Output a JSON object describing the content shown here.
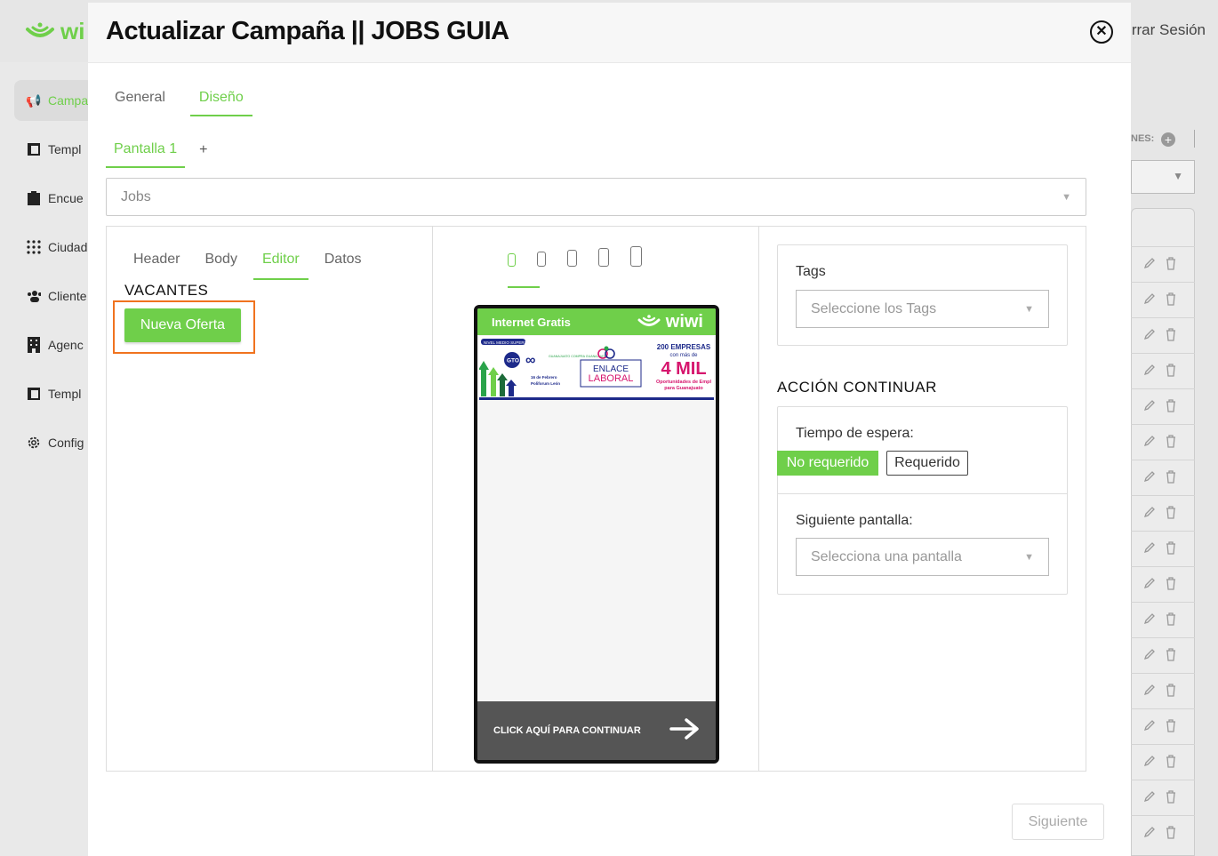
{
  "background": {
    "logo_text": "wi",
    "logout_label": "rrar Sesión",
    "sidebar": {
      "items": [
        {
          "label": "Campa",
          "icon": "megaphone-icon",
          "active": true
        },
        {
          "label": "Templ",
          "icon": "template-icon"
        },
        {
          "label": "Encue",
          "icon": "clipboard-icon"
        },
        {
          "label": "Ciudad",
          "icon": "grid-dots-icon"
        },
        {
          "label": "Cliente",
          "icon": "users-icon"
        },
        {
          "label": "Agenc",
          "icon": "building-icon"
        },
        {
          "label": "Templ",
          "icon": "template-icon"
        },
        {
          "label": "Config",
          "icon": "gear-icon"
        }
      ]
    },
    "right": {
      "label": "NES:"
    }
  },
  "modal": {
    "title": "Actualizar Campaña || JOBS GUIA",
    "tabs": [
      {
        "label": "General"
      },
      {
        "label": "Diseño",
        "active": true
      }
    ],
    "screen_tabs": [
      {
        "label": "Pantalla 1",
        "active": true
      }
    ],
    "add_screen_label": "+",
    "template_select": {
      "value": "Jobs"
    },
    "editor": {
      "tabs": [
        {
          "label": "Header"
        },
        {
          "label": "Body"
        },
        {
          "label": "Editor",
          "active": true
        },
        {
          "label": "Datos"
        }
      ],
      "section_title": "VACANTES",
      "new_offer_label": "Nueva Oferta"
    },
    "preview": {
      "header_text": "Internet Gratis",
      "logo_text": "wiwi",
      "banner": {
        "level": "NIVEL MEDIO SUPERIOR",
        "org1": "GTO",
        "org2": "GUANAJUATO COMPRA GUANAJUATO",
        "date": "16 de Febrero",
        "venue": "Poliforum León",
        "center_line1": "ENLACE",
        "center_line2": "LABORAL",
        "companies": "200 EMPRESAS",
        "with_more": "con más de",
        "big": "4 MIL",
        "opportunities": "Oportunidades de Empl",
        "region": "para Guanajuato"
      },
      "footer_text": "CLICK AQUÍ PARA CONTINUAR"
    },
    "settings": {
      "tags_label": "Tags",
      "tags_placeholder": "Seleccione los Tags",
      "action_title": "ACCIÓN CONTINUAR",
      "wait_label": "Tiempo de espera:",
      "not_required_label": "No requerido",
      "required_label": "Requerido",
      "next_screen_label": "Siguiente pantalla:",
      "next_screen_placeholder": "Selecciona una pantalla"
    },
    "next_button_label": "Siguiente"
  },
  "colors": {
    "accent": "#6fcf4a",
    "highlight": "#f0731f",
    "banner_blue": "#1d2a8a",
    "banner_magenta": "#d6156d"
  }
}
